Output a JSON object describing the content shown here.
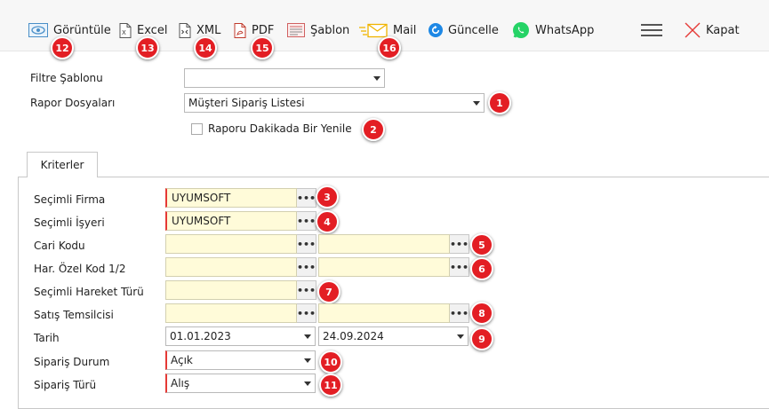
{
  "toolbar": {
    "view_label": "Görüntüle",
    "excel_label": "Excel",
    "xml_label": "XML",
    "pdf_label": "PDF",
    "template_label": "Şablon",
    "mail_label": "Mail",
    "refresh_label": "Güncelle",
    "whatsapp_label": "WhatsApp",
    "close_label": "Kapat",
    "icons": {
      "view": "eye-icon",
      "excel": "excel-file-icon",
      "xml": "xml-file-icon",
      "pdf": "pdf-file-icon",
      "template": "template-icon",
      "mail": "mail-icon",
      "refresh": "refresh-icon",
      "whatsapp": "whatsapp-icon",
      "menu": "hamburger-menu-icon",
      "close": "close-icon"
    }
  },
  "form": {
    "filter_template_label": "Filtre Şablonu",
    "filter_template_value": "",
    "report_files_label": "Rapor Dosyaları",
    "report_files_value": "Müşteri Sipariş Listesi",
    "refresh_checkbox_label": "Raporu Dakikada Bir Yenile",
    "refresh_checked": false
  },
  "tabs": [
    {
      "label": "Kriterler",
      "active": true
    }
  ],
  "criteria": {
    "dots": "•••",
    "company_label": "Seçimli Firma",
    "company_value": "UYUMSOFT",
    "workplace_label": "Seçimli İşyeri",
    "workplace_value": "UYUMSOFT",
    "account_code_label": "Cari Kodu",
    "account_code_from": "",
    "account_code_to": "",
    "special_code_label": "Har. Özel Kod 1/2",
    "special_code_1": "",
    "special_code_2": "",
    "movement_type_label": "Seçimli Hareket Türü",
    "movement_type_value": "",
    "sales_rep_label": "Satış Temsilcisi",
    "sales_rep_from": "",
    "sales_rep_to": "",
    "date_label": "Tarih",
    "date_from": "01.01.2023",
    "date_to": "24.09.2024",
    "order_status_label": "Sipariş Durum",
    "order_status_value": "Açık",
    "order_type_label": "Sipariş Türü",
    "order_type_value": "Alış"
  },
  "badges": [
    "1",
    "2",
    "3",
    "4",
    "5",
    "6",
    "7",
    "8",
    "9",
    "10",
    "11",
    "12",
    "13",
    "14",
    "15",
    "16"
  ],
  "colors": {
    "badge_red": "#e31e24",
    "required_border": "#e53935",
    "lookup_bg": "#fffbd9",
    "refresh_blue": "#1e88e5",
    "whatsapp_green": "#25d366",
    "close_red": "#e53935"
  }
}
